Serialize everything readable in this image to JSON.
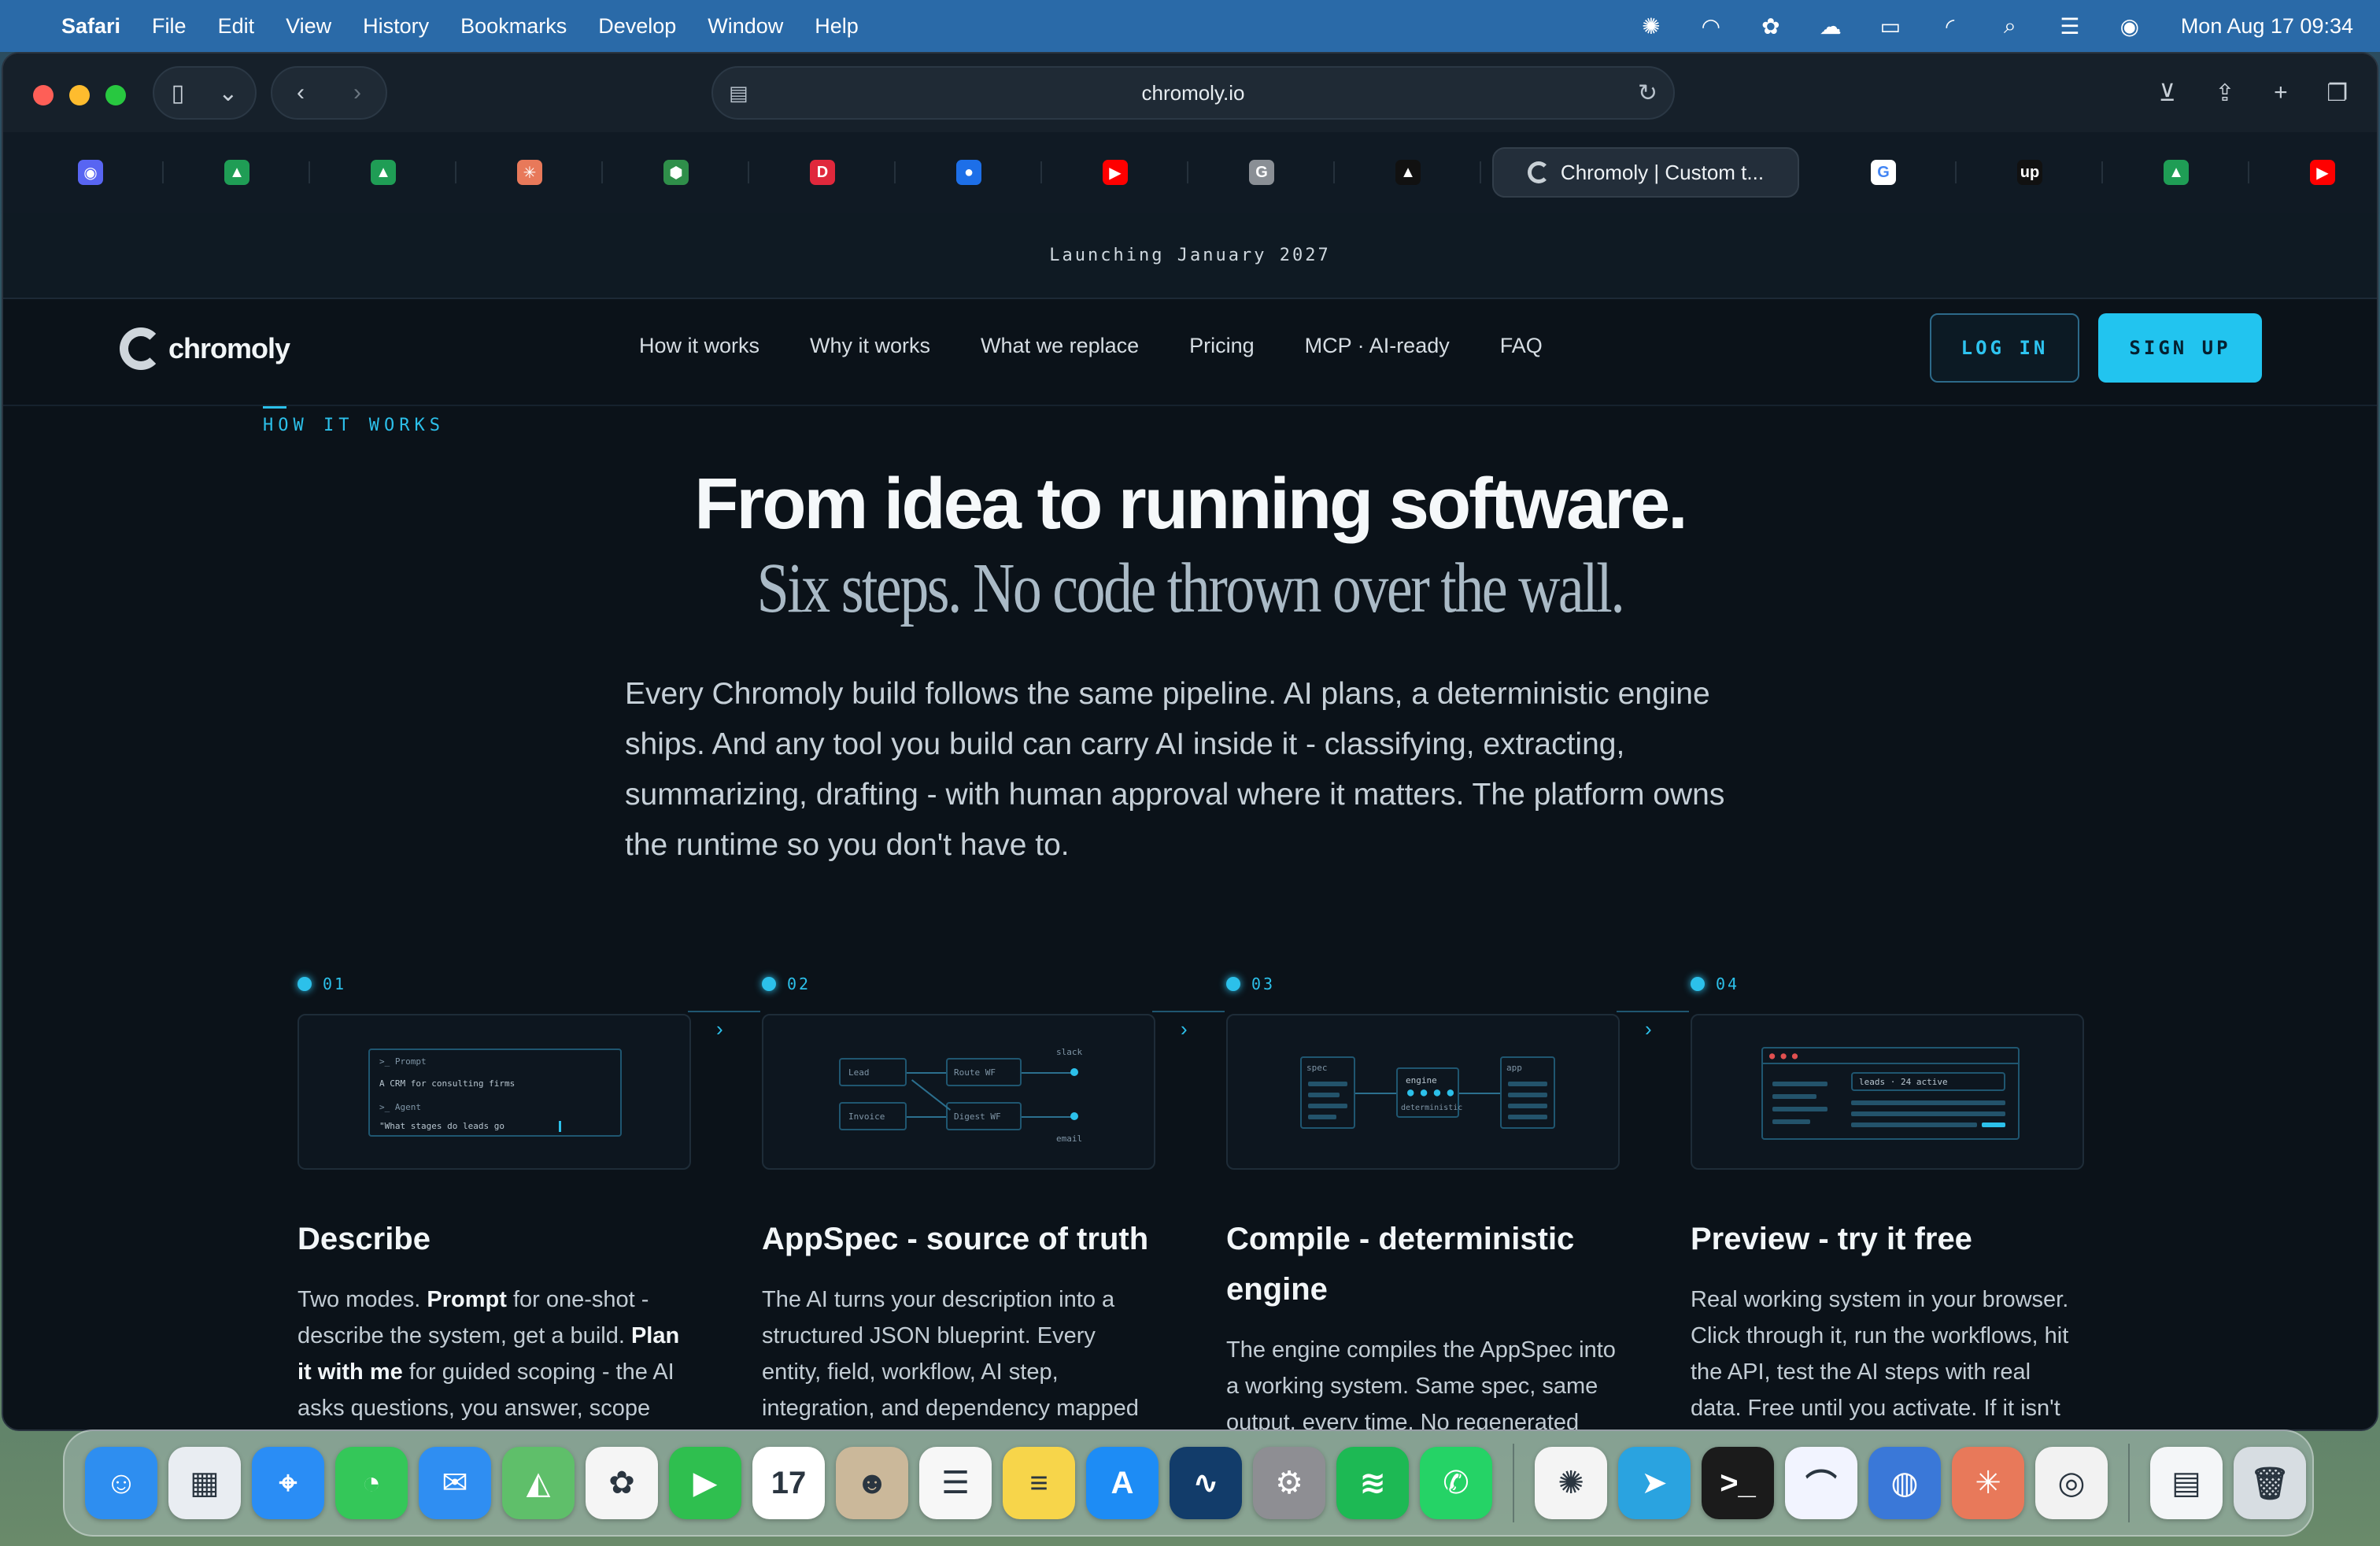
{
  "menubar": {
    "app": "Safari",
    "items": [
      "File",
      "Edit",
      "View",
      "History",
      "Bookmarks",
      "Develop",
      "Window",
      "Help"
    ],
    "clock": "Mon Aug 17  09:34"
  },
  "browser": {
    "url": "chromoly.io",
    "active_tab_title": "Chromoly | Custom t..."
  },
  "tabs": [
    {
      "icon": "discord-icon",
      "color": "#5865f2",
      "glyph": "◉"
    },
    {
      "icon": "google-drive-icon",
      "color": "#1f9d55",
      "glyph": "▲"
    },
    {
      "icon": "google-drive-icon",
      "color": "#1f9d55",
      "glyph": "▲"
    },
    {
      "icon": "claude-icon",
      "color": "#e8795a",
      "glyph": "✳"
    },
    {
      "icon": "cube-icon",
      "color": "#2f8f4a",
      "glyph": "⬢"
    },
    {
      "icon": "red-doc-icon",
      "color": "#e0283c",
      "glyph": "D"
    },
    {
      "icon": "blue-circle-icon",
      "color": "#1d6fe8",
      "glyph": "●"
    },
    {
      "icon": "youtube-icon",
      "color": "#ff0000",
      "glyph": "▶"
    },
    {
      "icon": "g-grey-icon",
      "color": "#8a8f95",
      "glyph": "G"
    },
    {
      "icon": "triangle-app-icon",
      "color": "#111111",
      "glyph": "▲"
    }
  ],
  "tabs_after": [
    {
      "icon": "google-icon",
      "color": "#ffffff",
      "glyph": "G"
    },
    {
      "icon": "upwork-icon",
      "color": "#111111",
      "glyph": "up"
    },
    {
      "icon": "google-drive-icon",
      "color": "#1f9d55",
      "glyph": "▲"
    },
    {
      "icon": "youtube-icon",
      "color": "#ff0000",
      "glyph": "▶"
    }
  ],
  "page": {
    "banner": "Launching January 2027",
    "brand": "chromoly",
    "nav": [
      "How it works",
      "Why it works",
      "What we replace",
      "Pricing",
      "MCP · AI-ready",
      "FAQ"
    ],
    "login": "LOG IN",
    "signup": "SIGN UP",
    "eyebrow": "HOW IT WORKS",
    "title": "From idea to running software.",
    "subtitle": "Six steps. No code thrown over the wall.",
    "lead": "Every Chromoly build follows the same pipeline. AI plans, a deterministic engine ships. And any tool you build can carry AI inside it - classifying, extracting, summarizing, drafting - with human approval where it matters. The platform owns the runtime so you don't have to."
  },
  "steps": [
    {
      "num": "01",
      "title": "Describe",
      "body_parts": [
        "Two modes. ",
        "Prompt",
        " for one-shot - describe the system, get a build. ",
        "Plan it with me",
        " for guided scoping - the AI asks questions, you answer, scope locks together."
      ],
      "mini": {
        "prompt_label": ">_ Prompt",
        "prompt_text": "A CRM for consulting firms",
        "agent_label": ">_ Agent",
        "agent_text": "\"What stages do leads go"
      }
    },
    {
      "num": "02",
      "title": "AppSpec - source of truth",
      "body": "The AI turns your description into a structured JSON blueprint. Every entity, field, workflow, AI step, integration, and dependency mapped",
      "mini": {
        "a": "Lead",
        "b": "Invoice",
        "c": "Route WF",
        "d": "Digest WF",
        "e": "slack",
        "f": "email"
      }
    },
    {
      "num": "03",
      "title": "Compile - deterministic engine",
      "body": "The engine compiles the AppSpec into a working system. Same spec, same output, every time. No regenerated code on every change, no drift, no",
      "mini": {
        "a": "spec",
        "b": "engine",
        "c": "deterministic",
        "d": "app"
      }
    },
    {
      "num": "04",
      "title": "Preview - try it free",
      "body": "Real working system in your browser. Click through it, run the workflows, hit the API, test the AI steps with real data. Free until you activate. If it isn't right, refine the prompt and regenerate.",
      "mini": {
        "a": "leads · 24 active"
      }
    }
  ],
  "dock": [
    {
      "name": "finder-icon",
      "color": "#2e8ef0",
      "glyph": "☺"
    },
    {
      "name": "launchpad-icon",
      "color": "#e9edf2",
      "glyph": "▦"
    },
    {
      "name": "safari-icon",
      "color": "#2a8df5",
      "glyph": "⌖"
    },
    {
      "name": "messages-icon",
      "color": "#34c759",
      "glyph": "◔"
    },
    {
      "name": "mail-icon",
      "color": "#2f8ef2",
      "glyph": "✉"
    },
    {
      "name": "maps-icon",
      "color": "#5fbf6a",
      "glyph": "◭"
    },
    {
      "name": "photos-icon",
      "color": "#f5f5f5",
      "glyph": "✿"
    },
    {
      "name": "facetime-icon",
      "color": "#2fbf4f",
      "glyph": "▶"
    },
    {
      "name": "calendar-icon",
      "color": "#ffffff",
      "glyph": "17"
    },
    {
      "name": "contacts-icon",
      "color": "#cbb89a",
      "glyph": "☻"
    },
    {
      "name": "reminders-icon",
      "color": "#f7f7f7",
      "glyph": "☰"
    },
    {
      "name": "notes-icon",
      "color": "#f7d54a",
      "glyph": "≡"
    },
    {
      "name": "app-store-icon",
      "color": "#1d8cf5",
      "glyph": "A"
    },
    {
      "name": "freeform-icon",
      "color": "#123c6a",
      "glyph": "∿"
    },
    {
      "name": "system-settings-icon",
      "color": "#8e8e93",
      "glyph": "⚙"
    },
    {
      "name": "spotify-icon",
      "color": "#1db954",
      "glyph": "≋"
    },
    {
      "name": "whatsapp-icon",
      "color": "#25d366",
      "glyph": "✆"
    }
  ],
  "dock_right": [
    {
      "name": "chatgpt-icon",
      "color": "#f4f4f4",
      "glyph": "✺"
    },
    {
      "name": "telegram-icon",
      "color": "#2aa3e0",
      "glyph": "➤"
    },
    {
      "name": "terminal-icon",
      "color": "#1b1b1b",
      "glyph": ">_"
    },
    {
      "name": "arc-icon",
      "color": "#f2f4ff",
      "glyph": "⌒"
    },
    {
      "name": "database-icon",
      "color": "#3a78d8",
      "glyph": "◍"
    },
    {
      "name": "claude-icon",
      "color": "#e8795a",
      "glyph": "✳"
    },
    {
      "name": "chrome-icon",
      "color": "#f2f2f2",
      "glyph": "◎"
    }
  ],
  "dock_end": [
    {
      "name": "document-icon",
      "color": "#f4f6f8",
      "glyph": "▤"
    },
    {
      "name": "trash-icon",
      "color": "#d7dde2",
      "glyph": "🗑"
    }
  ]
}
